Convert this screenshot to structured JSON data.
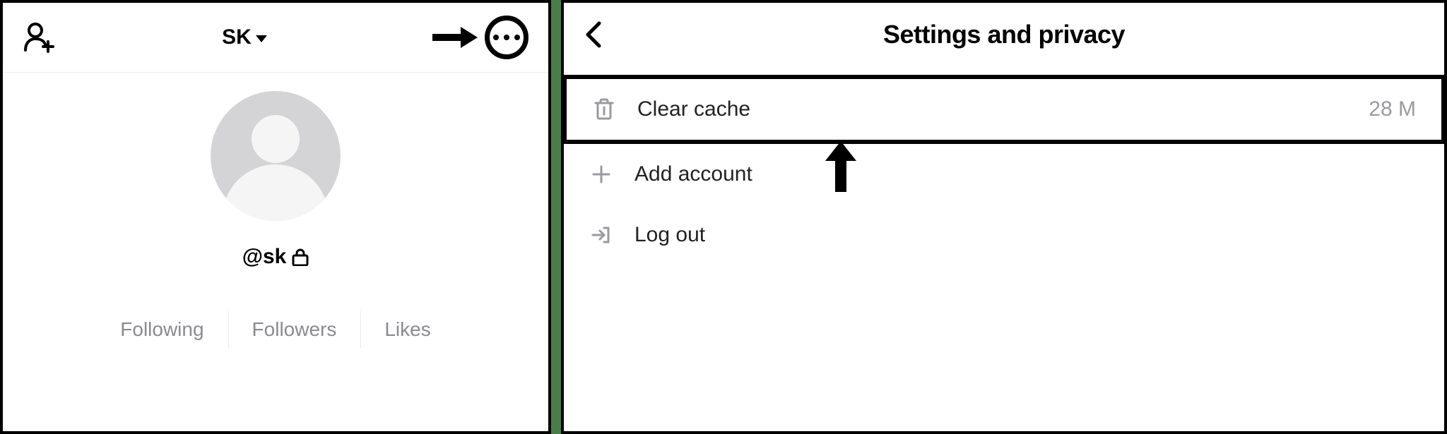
{
  "left": {
    "header": {
      "username": "SK"
    },
    "handle": "@sk",
    "stats": {
      "following": "Following",
      "followers": "Followers",
      "likes": "Likes"
    }
  },
  "right": {
    "title": "Settings and privacy",
    "items": [
      {
        "label": "Clear cache",
        "value": "28 M"
      },
      {
        "label": "Add account"
      },
      {
        "label": "Log out"
      }
    ]
  }
}
